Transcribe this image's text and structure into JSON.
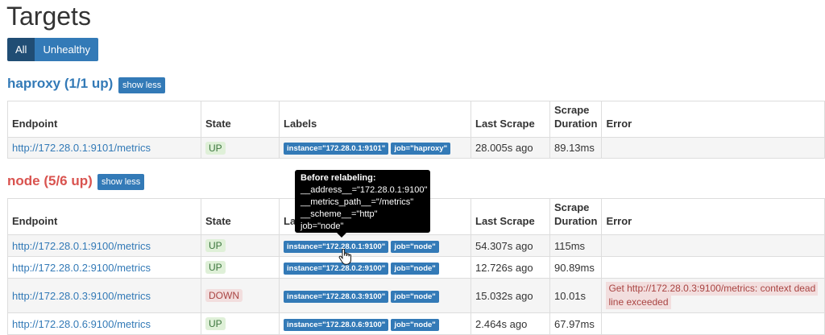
{
  "page_title": "Targets",
  "filters": {
    "all": "All",
    "unhealthy": "Unhealthy"
  },
  "columns": {
    "endpoint": "Endpoint",
    "state": "State",
    "labels": "Labels",
    "last_scrape": "Last Scrape",
    "scrape_duration_1": "Scrape",
    "scrape_duration_2": "Duration",
    "error": "Error"
  },
  "haproxy": {
    "title": "haproxy (1/1 up)",
    "toggle": "show less",
    "rows": [
      {
        "endpoint": "http://172.28.0.1:9101/metrics",
        "state": "UP",
        "instance": "instance=\"172.28.0.1:9101\"",
        "job": "job=\"haproxy\"",
        "last_scrape": "28.005s ago",
        "duration": "89.13ms",
        "error": ""
      }
    ]
  },
  "node": {
    "title": "node (5/6 up)",
    "toggle": "show less",
    "rows": [
      {
        "endpoint": "http://172.28.0.1:9100/metrics",
        "state": "UP",
        "instance": "instance=\"172.28.0.1:9100\"",
        "job": "job=\"node\"",
        "last_scrape": "54.307s ago",
        "duration": "115ms",
        "error": ""
      },
      {
        "endpoint": "http://172.28.0.2:9100/metrics",
        "state": "UP",
        "instance": "instance=\"172.28.0.2:9100\"",
        "job": "job=\"node\"",
        "last_scrape": "12.726s ago",
        "duration": "90.89ms",
        "error": ""
      },
      {
        "endpoint": "http://172.28.0.3:9100/metrics",
        "state": "DOWN",
        "instance": "instance=\"172.28.0.3:9100\"",
        "job": "job=\"node\"",
        "last_scrape": "15.032s ago",
        "duration": "10.01s",
        "error_line1": "Get http://172.28.0.3:9100/metrics: context dead",
        "error_line2": "line exceeded"
      },
      {
        "endpoint": "http://172.28.0.6:9100/metrics",
        "state": "UP",
        "instance": "instance=\"172.28.0.6:9100\"",
        "job": "job=\"node\"",
        "last_scrape": "2.464s ago",
        "duration": "67.97ms",
        "error": ""
      }
    ]
  },
  "tooltip": {
    "title": "Before relabeling:",
    "lines": [
      "__address__=\"172.28.0.1:9100\"",
      "__metrics_path__=\"/metrics\"",
      "__scheme__=\"http\"",
      "job=\"node\""
    ]
  },
  "colors": {
    "accent": "#337ab7",
    "active": "#204d74",
    "danger": "#d9534f",
    "up_bg": "#dff0d8",
    "down_bg": "#f2dede"
  },
  "icons": {
    "cursor": "hand-pointer-icon"
  }
}
